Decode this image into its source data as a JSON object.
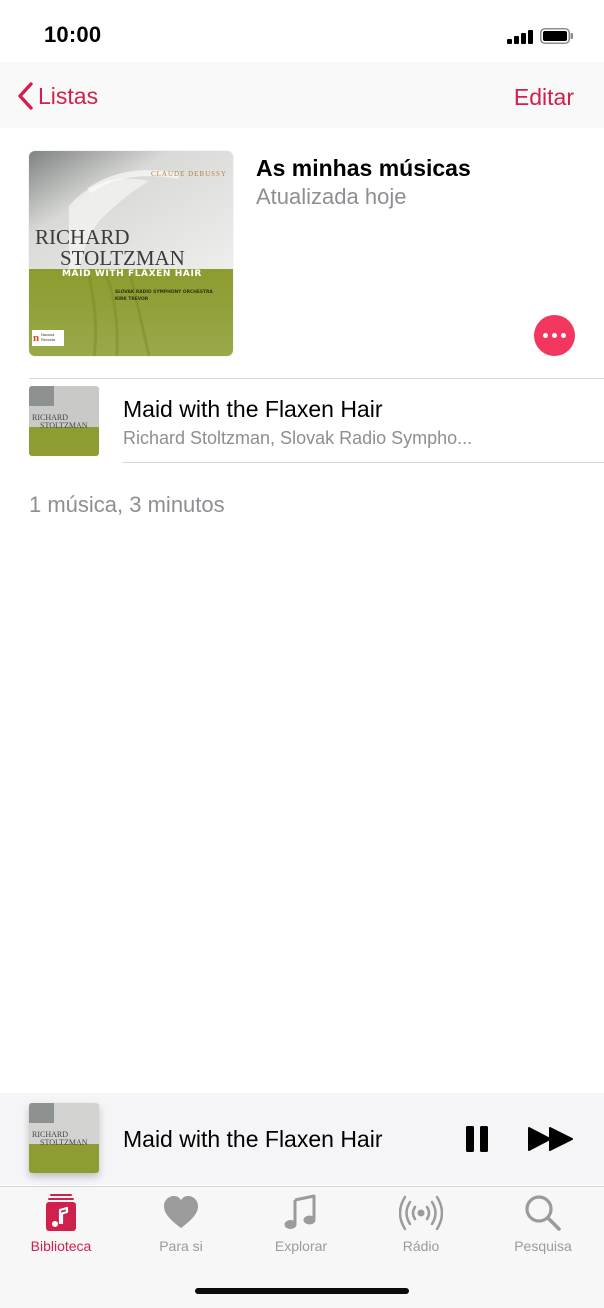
{
  "status_bar": {
    "time": "10:00"
  },
  "nav": {
    "back_label": "Listas",
    "edit_label": "Editar"
  },
  "playlist": {
    "title": "As minhas músicas",
    "subtitle": "Atualizada hoje",
    "summary": "1 música, 3 minutos"
  },
  "album_art": {
    "composer": "CLAUDE DEBUSSY",
    "artist_line1": "RICHARD",
    "artist_line2": "STOLTZMAN",
    "album": "MAID WITH FLAXEN HAIR",
    "credit1": "SLOVAK RADIO SYMPHONY ORCHESTRA",
    "credit2": "KIRK TREVOR",
    "label_line1": "Navona",
    "label_line2": "Records"
  },
  "songs": [
    {
      "title": "Maid with the Flaxen Hair",
      "artist": "Richard Stoltzman, Slovak Radio Sympho..."
    }
  ],
  "mini_player": {
    "title": "Maid with the Flaxen Hair"
  },
  "tabs": [
    {
      "label": "Biblioteca",
      "icon": "library-icon",
      "active": true
    },
    {
      "label": "Para si",
      "icon": "heart-icon",
      "active": false
    },
    {
      "label": "Explorar",
      "icon": "music-note-icon",
      "active": false
    },
    {
      "label": "Rádio",
      "icon": "radio-icon",
      "active": false
    },
    {
      "label": "Pesquisa",
      "icon": "search-icon",
      "active": false
    }
  ],
  "colors": {
    "accent": "#d0204e",
    "more_button": "#f2365e",
    "cover_green": "#8e9c32",
    "secondary_text": "#8e8e93"
  }
}
